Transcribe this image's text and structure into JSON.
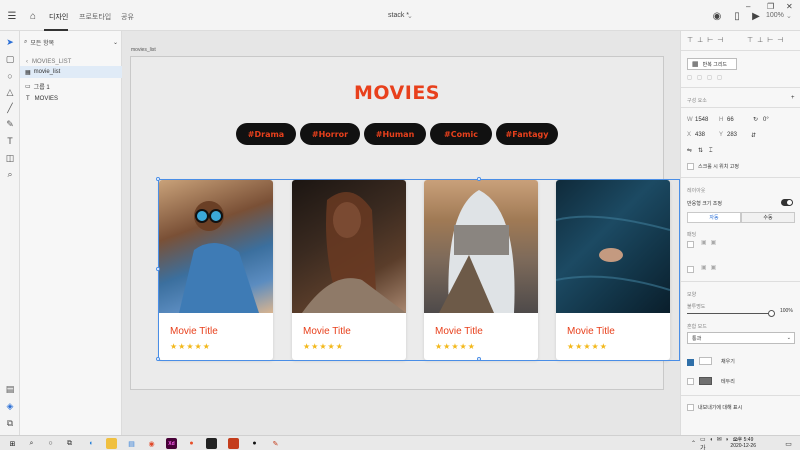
{
  "header": {
    "tabs": [
      "디자인",
      "프로토타입",
      "공유"
    ],
    "doc_title": "stack *",
    "zoom": "100%"
  },
  "layers": {
    "search_placeholder": "모든 항목",
    "breadcrumb": "MOVIES_LIST",
    "items": [
      "movie_list",
      "그룹 1",
      "MOVIES"
    ]
  },
  "canvas": {
    "artboard_label": "movies_list",
    "page_title": "MOVIES",
    "tags": [
      "#Drama",
      "#Horror",
      "#Human",
      "#Comic",
      "#Fantagy"
    ],
    "cards": [
      {
        "title": "Movie Title",
        "rating": 5,
        "stars": "★★★★★"
      },
      {
        "title": "Movie Title",
        "rating": 5,
        "stars": "★★★★★"
      },
      {
        "title": "Movie Title",
        "rating": 5,
        "stars": "★★★★★"
      },
      {
        "title": "Movie Title",
        "rating": 5,
        "stars": "★★★★★"
      }
    ]
  },
  "properties": {
    "repeat_grid": "반복 그리드",
    "transform_label": "구성 요소",
    "w": "1548",
    "h": "66",
    "rotation": "0°",
    "x": "438",
    "y": "283",
    "fix_scroll": "스크롤 시 위치 고정",
    "layout_label": "레이아웃",
    "responsive": "반응형 크기 조정",
    "auto": "자동",
    "manual": "수동",
    "padding": "패딩",
    "appearance": "모양",
    "opacity_label": "불투명도",
    "opacity": "100%",
    "blend_label": "혼합 모드",
    "blend": "통과",
    "fill": "채우기",
    "border": "테두리",
    "export": "내보내기에 대해 표시"
  },
  "taskbar": {
    "time": "오후 5:49",
    "date": "2020-12-26"
  },
  "colors": {
    "accent": "#e8401c",
    "star": "#f3b81a",
    "pill_bg": "#111111",
    "selection": "#4a8ee6"
  }
}
